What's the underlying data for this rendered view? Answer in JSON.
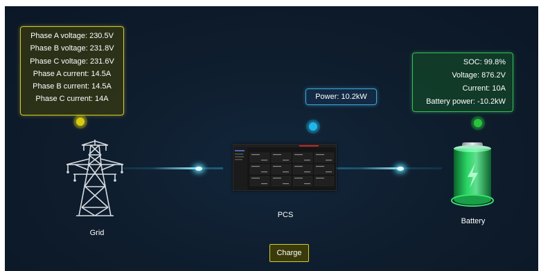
{
  "grid": {
    "label": "Grid",
    "stats": [
      "Phase A voltage: 230.5V",
      "Phase B voltage: 231.8V",
      "Phase C voltage: 231.6V",
      "Phase A current: 14.5A",
      "Phase B current: 14.5A",
      "Phase C current: 14A"
    ]
  },
  "pcs": {
    "label": "PCS",
    "power": "Power: 10.2kW"
  },
  "battery": {
    "label": "Battery",
    "stats": [
      "SOC: 99.8%",
      "Voltage: 876.2V",
      "Current: 10A",
      "Battery power: -10.2kW"
    ]
  },
  "actions": {
    "charge_label": "Charge"
  },
  "colors": {
    "grid_accent": "#d8cc2a",
    "pcs_accent": "#3fa8d8",
    "battery_accent": "#37c05a",
    "flow": "#5fe0ff"
  }
}
